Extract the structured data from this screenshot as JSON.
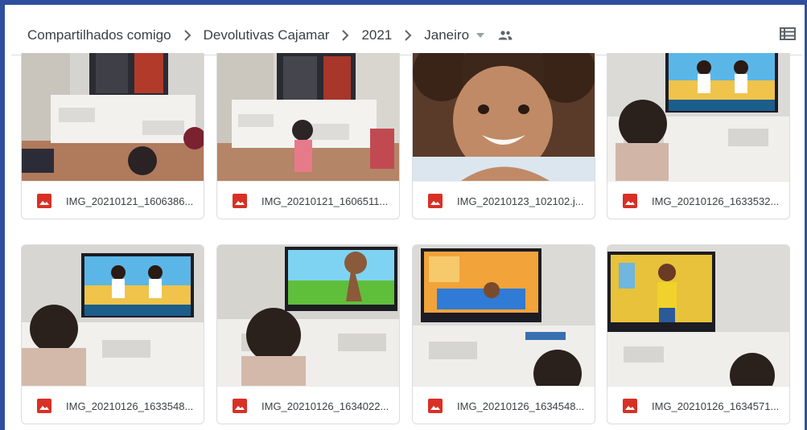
{
  "breadcrumb": {
    "items": [
      "Compartilhados comigo",
      "Devolutivas Cajamar",
      "2021",
      "Janeiro"
    ]
  },
  "icons": {
    "separator": "chevron-right-icon",
    "dropdown": "arrow-drop-down-icon",
    "shared": "people-icon",
    "view": "list-view-icon",
    "file": "image-file-icon"
  },
  "colors": {
    "frame": "#2f4f9e",
    "file_icon": "#d93025"
  },
  "files": [
    {
      "name": "IMG_20210121_1606386..."
    },
    {
      "name": "IMG_20210121_1606511..."
    },
    {
      "name": "IMG_20210123_102102.j..."
    },
    {
      "name": "IMG_20210126_1633532..."
    },
    {
      "name": "IMG_20210126_1633548..."
    },
    {
      "name": "IMG_20210126_1634022..."
    },
    {
      "name": "IMG_20210126_1634548..."
    },
    {
      "name": "IMG_20210126_1634571..."
    }
  ]
}
